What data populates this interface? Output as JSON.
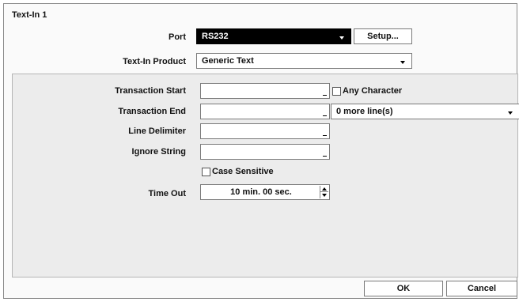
{
  "dialog": {
    "title": "Text-In 1",
    "port": {
      "label": "Port",
      "value": "RS232",
      "setup_label": "Setup..."
    },
    "product": {
      "label": "Text-In Product",
      "value": "Generic Text"
    },
    "transaction_start": {
      "label": "Transaction Start",
      "value": "",
      "any_character_label": "Any Character",
      "any_character_checked": false
    },
    "transaction_end": {
      "label": "Transaction End",
      "value": "",
      "more_lines_value": "0 more line(s)"
    },
    "line_delimiter": {
      "label": "Line Delimiter",
      "value": ""
    },
    "ignore_string": {
      "label": "Ignore String",
      "value": ""
    },
    "case_sensitive": {
      "label": "Case Sensitive",
      "checked": false
    },
    "time_out": {
      "label": "Time Out",
      "value": "10 min. 00 sec."
    },
    "ok_label": "OK",
    "cancel_label": "Cancel"
  },
  "icons": [
    "dropdown-arrow-icon",
    "spinner-up-icon",
    "spinner-down-icon",
    "checkbox-icon"
  ]
}
